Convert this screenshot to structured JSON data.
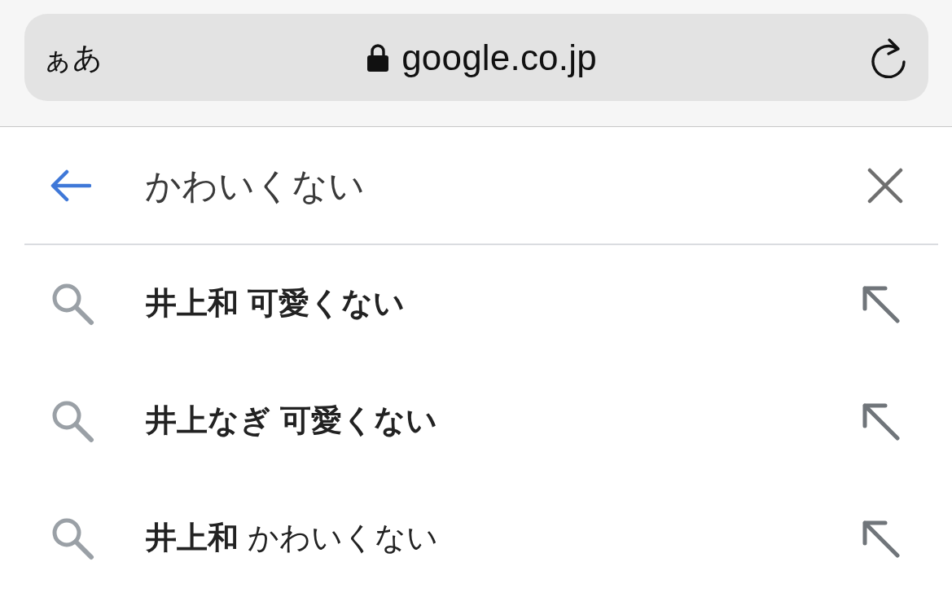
{
  "address_bar": {
    "text_size_button": "ぁあ",
    "url": "google.co.jp"
  },
  "search": {
    "query": "かわいくない"
  },
  "suggestions": [
    {
      "text": "井上和 可愛くない",
      "bold": true
    },
    {
      "text": "井上なぎ 可愛くない",
      "bold": true
    },
    {
      "text": "**井上和** かわいくない",
      "bold": false
    }
  ]
}
